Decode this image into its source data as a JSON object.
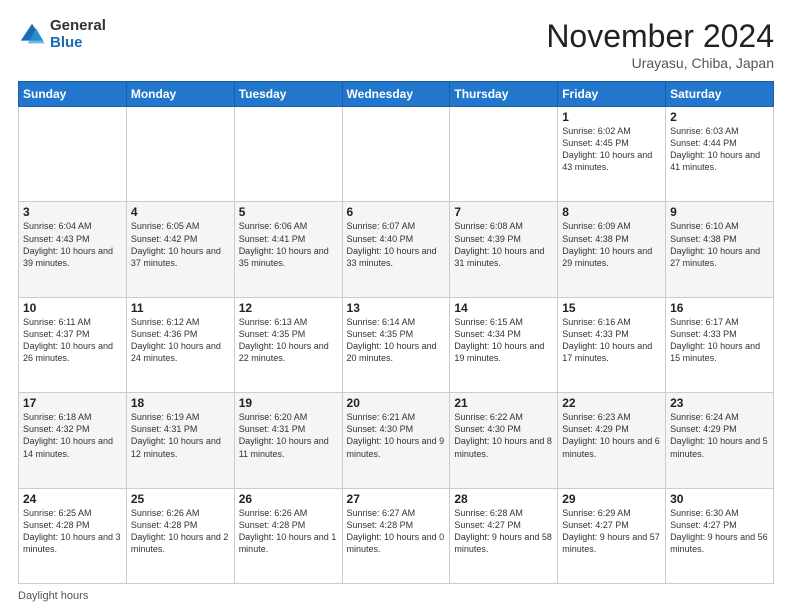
{
  "logo": {
    "general": "General",
    "blue": "Blue"
  },
  "header": {
    "month_title": "November 2024",
    "location": "Urayasu, Chiba, Japan"
  },
  "weekdays": [
    "Sunday",
    "Monday",
    "Tuesday",
    "Wednesday",
    "Thursday",
    "Friday",
    "Saturday"
  ],
  "weeks": [
    [
      {
        "day": "",
        "info": ""
      },
      {
        "day": "",
        "info": ""
      },
      {
        "day": "",
        "info": ""
      },
      {
        "day": "",
        "info": ""
      },
      {
        "day": "",
        "info": ""
      },
      {
        "day": "1",
        "info": "Sunrise: 6:02 AM\nSunset: 4:45 PM\nDaylight: 10 hours and 43 minutes."
      },
      {
        "day": "2",
        "info": "Sunrise: 6:03 AM\nSunset: 4:44 PM\nDaylight: 10 hours and 41 minutes."
      }
    ],
    [
      {
        "day": "3",
        "info": "Sunrise: 6:04 AM\nSunset: 4:43 PM\nDaylight: 10 hours and 39 minutes."
      },
      {
        "day": "4",
        "info": "Sunrise: 6:05 AM\nSunset: 4:42 PM\nDaylight: 10 hours and 37 minutes."
      },
      {
        "day": "5",
        "info": "Sunrise: 6:06 AM\nSunset: 4:41 PM\nDaylight: 10 hours and 35 minutes."
      },
      {
        "day": "6",
        "info": "Sunrise: 6:07 AM\nSunset: 4:40 PM\nDaylight: 10 hours and 33 minutes."
      },
      {
        "day": "7",
        "info": "Sunrise: 6:08 AM\nSunset: 4:39 PM\nDaylight: 10 hours and 31 minutes."
      },
      {
        "day": "8",
        "info": "Sunrise: 6:09 AM\nSunset: 4:38 PM\nDaylight: 10 hours and 29 minutes."
      },
      {
        "day": "9",
        "info": "Sunrise: 6:10 AM\nSunset: 4:38 PM\nDaylight: 10 hours and 27 minutes."
      }
    ],
    [
      {
        "day": "10",
        "info": "Sunrise: 6:11 AM\nSunset: 4:37 PM\nDaylight: 10 hours and 26 minutes."
      },
      {
        "day": "11",
        "info": "Sunrise: 6:12 AM\nSunset: 4:36 PM\nDaylight: 10 hours and 24 minutes."
      },
      {
        "day": "12",
        "info": "Sunrise: 6:13 AM\nSunset: 4:35 PM\nDaylight: 10 hours and 22 minutes."
      },
      {
        "day": "13",
        "info": "Sunrise: 6:14 AM\nSunset: 4:35 PM\nDaylight: 10 hours and 20 minutes."
      },
      {
        "day": "14",
        "info": "Sunrise: 6:15 AM\nSunset: 4:34 PM\nDaylight: 10 hours and 19 minutes."
      },
      {
        "day": "15",
        "info": "Sunrise: 6:16 AM\nSunset: 4:33 PM\nDaylight: 10 hours and 17 minutes."
      },
      {
        "day": "16",
        "info": "Sunrise: 6:17 AM\nSunset: 4:33 PM\nDaylight: 10 hours and 15 minutes."
      }
    ],
    [
      {
        "day": "17",
        "info": "Sunrise: 6:18 AM\nSunset: 4:32 PM\nDaylight: 10 hours and 14 minutes."
      },
      {
        "day": "18",
        "info": "Sunrise: 6:19 AM\nSunset: 4:31 PM\nDaylight: 10 hours and 12 minutes."
      },
      {
        "day": "19",
        "info": "Sunrise: 6:20 AM\nSunset: 4:31 PM\nDaylight: 10 hours and 11 minutes."
      },
      {
        "day": "20",
        "info": "Sunrise: 6:21 AM\nSunset: 4:30 PM\nDaylight: 10 hours and 9 minutes."
      },
      {
        "day": "21",
        "info": "Sunrise: 6:22 AM\nSunset: 4:30 PM\nDaylight: 10 hours and 8 minutes."
      },
      {
        "day": "22",
        "info": "Sunrise: 6:23 AM\nSunset: 4:29 PM\nDaylight: 10 hours and 6 minutes."
      },
      {
        "day": "23",
        "info": "Sunrise: 6:24 AM\nSunset: 4:29 PM\nDaylight: 10 hours and 5 minutes."
      }
    ],
    [
      {
        "day": "24",
        "info": "Sunrise: 6:25 AM\nSunset: 4:28 PM\nDaylight: 10 hours and 3 minutes."
      },
      {
        "day": "25",
        "info": "Sunrise: 6:26 AM\nSunset: 4:28 PM\nDaylight: 10 hours and 2 minutes."
      },
      {
        "day": "26",
        "info": "Sunrise: 6:26 AM\nSunset: 4:28 PM\nDaylight: 10 hours and 1 minute."
      },
      {
        "day": "27",
        "info": "Sunrise: 6:27 AM\nSunset: 4:28 PM\nDaylight: 10 hours and 0 minutes."
      },
      {
        "day": "28",
        "info": "Sunrise: 6:28 AM\nSunset: 4:27 PM\nDaylight: 9 hours and 58 minutes."
      },
      {
        "day": "29",
        "info": "Sunrise: 6:29 AM\nSunset: 4:27 PM\nDaylight: 9 hours and 57 minutes."
      },
      {
        "day": "30",
        "info": "Sunrise: 6:30 AM\nSunset: 4:27 PM\nDaylight: 9 hours and 56 minutes."
      }
    ]
  ],
  "footer": {
    "label": "Daylight hours"
  }
}
